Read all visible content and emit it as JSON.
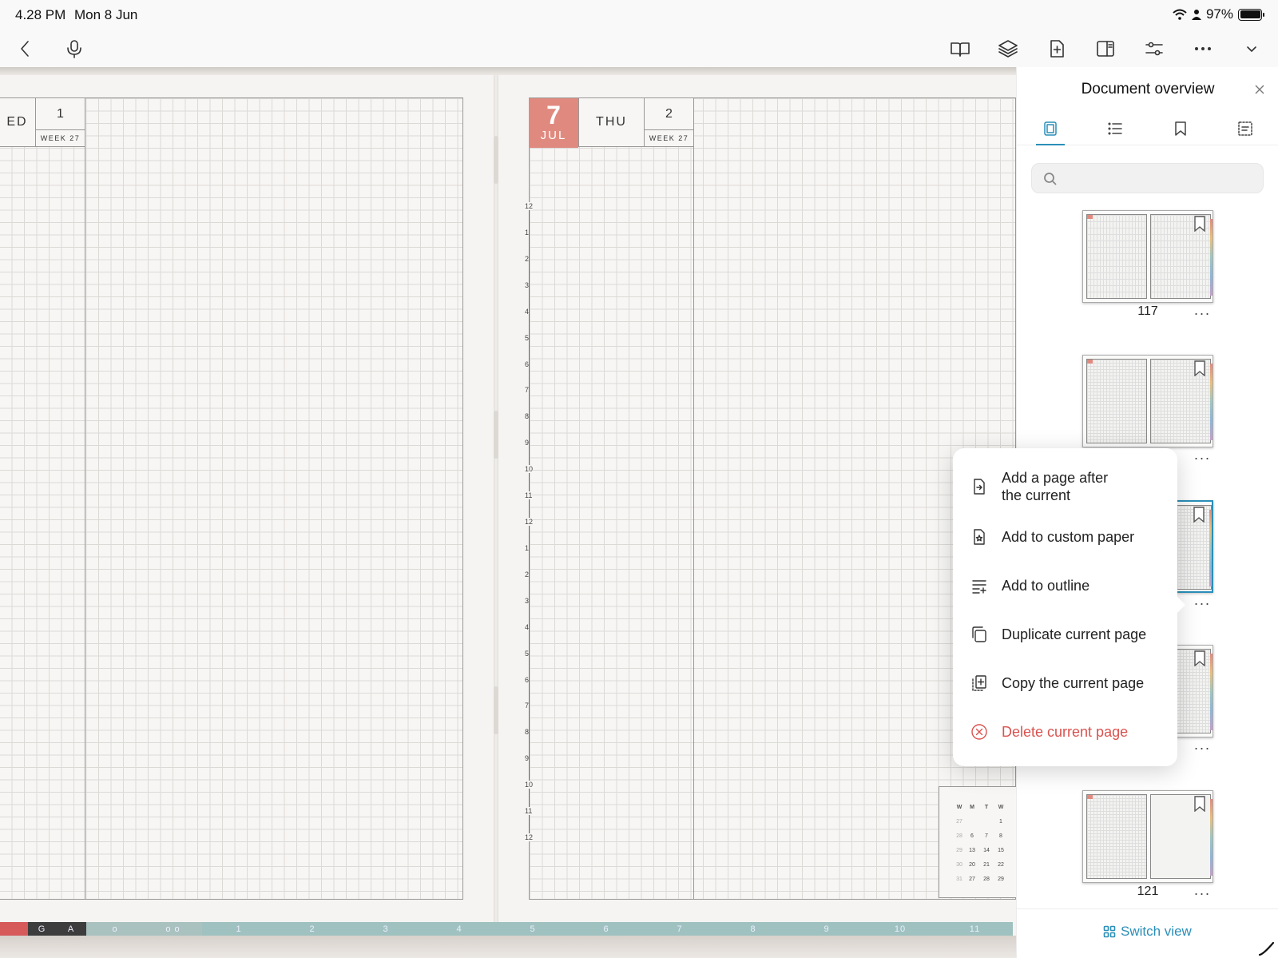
{
  "status": {
    "time": "4.28 PM",
    "date": "Mon 8 Jun",
    "battery": "97%"
  },
  "toolbar": {
    "left": [
      {
        "icon": "back-chevron-icon"
      },
      {
        "icon": "microphone-icon"
      }
    ],
    "right": [
      {
        "icon": "book-reader-icon"
      },
      {
        "icon": "layers-icon"
      },
      {
        "icon": "add-page-icon"
      },
      {
        "icon": "split-view-icon"
      },
      {
        "icon": "sliders-icon"
      },
      {
        "icon": "more-icon"
      },
      {
        "icon": "chevron-down-icon"
      }
    ]
  },
  "planner": {
    "left_page": {
      "day_partial": "ED",
      "day_num": "1",
      "week": "WEEK 27"
    },
    "right_page": {
      "date_num": "7",
      "month": "JUL",
      "weekday": "THU",
      "day_num": "2",
      "week": "WEEK 27"
    },
    "hours": [
      "12",
      "1",
      "2",
      "3",
      "4",
      "5",
      "6",
      "7",
      "8",
      "9",
      "10",
      "11",
      "12",
      "1",
      "2",
      "3",
      "4",
      "5",
      "6",
      "7",
      "8",
      "9",
      "10",
      "11",
      "12"
    ],
    "mini_calendar": {
      "header": [
        "W",
        "M",
        "T",
        "W"
      ],
      "rows": [
        [
          "27",
          "",
          "",
          "1"
        ],
        [
          "28",
          "6",
          "7",
          "8"
        ],
        [
          "29",
          "13",
          "14",
          "15"
        ],
        [
          "30",
          "20",
          "21",
          "22"
        ],
        [
          "31",
          "27",
          "28",
          "29"
        ]
      ]
    },
    "bottom_tabs": [
      "G",
      "A",
      "o",
      "o o",
      "1",
      "2",
      "3",
      "4",
      "5",
      "6",
      "7",
      "8",
      "9",
      "10",
      "11"
    ]
  },
  "panel": {
    "title": "Document overview",
    "tabs": [
      "thumbnails-icon",
      "outline-list-icon",
      "bookmark-icon",
      "annotations-icon"
    ],
    "search_placeholder": "",
    "thumbnails": [
      {
        "page": "117"
      },
      {
        "page": ""
      },
      {
        "page": "",
        "current": true
      },
      {
        "page": ""
      },
      {
        "page": "121"
      }
    ],
    "more_label": "···",
    "switch_view": "Switch view"
  },
  "context_menu": {
    "items": [
      {
        "label_line1": "Add a page after",
        "label_line2": "the current",
        "icon": "add-page-after-icon"
      },
      {
        "label": "Add to custom paper",
        "icon": "custom-paper-icon"
      },
      {
        "label": "Add to outline",
        "icon": "add-outline-icon"
      },
      {
        "label": "Duplicate current page",
        "icon": "duplicate-icon"
      },
      {
        "label": "Copy the current page",
        "icon": "copy-page-icon"
      },
      {
        "label": "Delete current page",
        "icon": "delete-icon",
        "danger": true
      }
    ]
  },
  "colors": {
    "accent": "#2a8fb8",
    "date_tag": "#e08a7f",
    "danger": "#d9534f"
  }
}
